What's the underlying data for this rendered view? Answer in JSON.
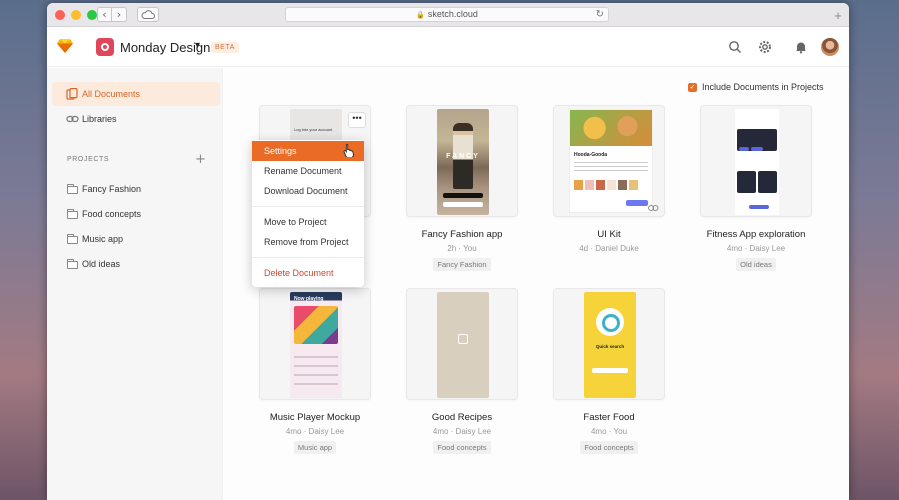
{
  "browser": {
    "url": "sketch.cloud",
    "back_icon": "‹",
    "forward_icon": "›",
    "reload_icon": "↻",
    "new_tab_icon": "+"
  },
  "header": {
    "workspace_name": "Monday Design",
    "chevron": "▾",
    "beta_label": "BETA"
  },
  "sidebar": {
    "all_documents": "All Documents",
    "libraries": "Libraries",
    "projects_label": "PROJECTS",
    "add_project": "+",
    "projects": [
      "Fancy Fashion",
      "Food concepts",
      "Music app",
      "Old ideas"
    ]
  },
  "main": {
    "include_label": "Include Documents in Projects",
    "include_checked": "✓"
  },
  "documents": [
    {
      "title": "",
      "meta": "",
      "tag": "",
      "login_text": "Log into your account",
      "more": "•••"
    },
    {
      "title": "Fancy Fashion app",
      "meta": "2h · You",
      "tag": "Fancy Fashion",
      "brand": "FANCY"
    },
    {
      "title": "UI Kit",
      "meta": "4d · Daniel Duke",
      "tag": "",
      "card_title": "Hooda-Gooda"
    },
    {
      "title": "Fitness App exploration",
      "meta": "4mo · Daisy Lee",
      "tag": "Old ideas"
    },
    {
      "title": "Music Player Mockup",
      "meta": "4mo · Daisy Lee",
      "tag": "Music app",
      "now_playing": "Now playing"
    },
    {
      "title": "Good Recipes",
      "meta": "4mo · Daisy Lee",
      "tag": "Food concepts"
    },
    {
      "title": "Faster Food",
      "meta": "4mo · You",
      "tag": "Food concepts",
      "screen_title": "Quick search"
    }
  ],
  "context_menu": {
    "items": [
      "Settings",
      "Rename Document",
      "Download Document",
      "Move to Project",
      "Remove from Project",
      "Delete Document"
    ]
  },
  "colors": {
    "accent": "#ea6b25",
    "active_bg": "#fcebdc",
    "danger": "#d9432d"
  }
}
